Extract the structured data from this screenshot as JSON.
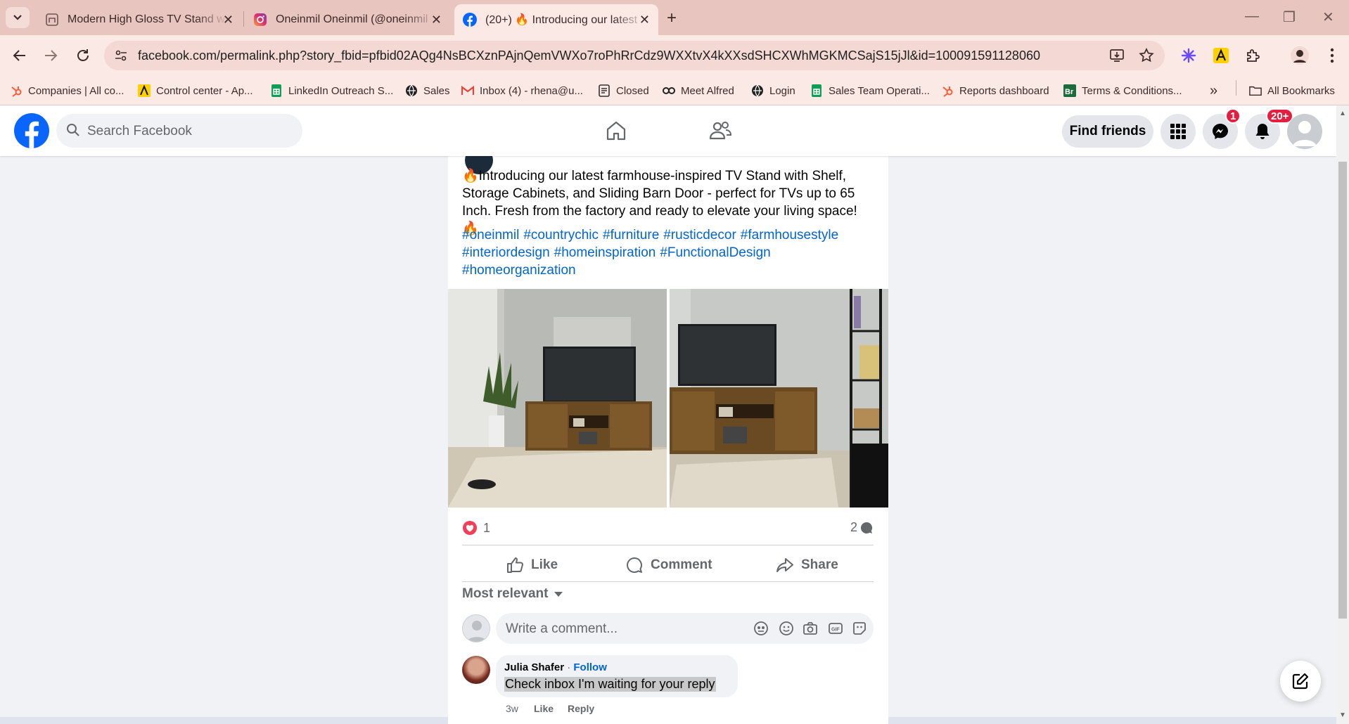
{
  "browser": {
    "tabs": [
      {
        "title": "Modern High Gloss TV Stand w"
      },
      {
        "title": "Oneinmil Oneinmil (@oneinmil"
      },
      {
        "title": "(20+) 🔥 Introducing our latest"
      }
    ],
    "url": "facebook.com/permalink.php?story_fbid=pfbid02AQg4NsBCXznPAjnQemVWXo7roPhRrCdz9WXXtvX4kXXsdSHCXWhMGKMCSajS15jJl&id=100091591128060",
    "bookmarks": [
      {
        "label": "Companies | All co...",
        "icon": "hubspot-icon"
      },
      {
        "label": "Control center - Ap...",
        "icon": "apollo-icon"
      },
      {
        "label": "LinkedIn Outreach S...",
        "icon": "sheets-icon"
      },
      {
        "label": "Sales",
        "icon": "globe-icon"
      },
      {
        "label": "Inbox (4) - rhena@u...",
        "icon": "gmail-icon"
      },
      {
        "label": "Closed",
        "icon": "doc-icon"
      },
      {
        "label": "Meet Alfred",
        "icon": "alfred-icon"
      },
      {
        "label": "Login",
        "icon": "globe-icon"
      },
      {
        "label": "Sales Team Operati...",
        "icon": "sheets-icon"
      },
      {
        "label": "Reports dashboard",
        "icon": "hubspot-icon"
      },
      {
        "label": "Terms & Conditions...",
        "icon": "br-icon"
      }
    ],
    "all_bookmarks": "All Bookmarks",
    "overflow": "»"
  },
  "facebook": {
    "search_placeholder": "Search Facebook",
    "find_friends": "Find friends",
    "messenger_badge": "1",
    "notifications_badge": "20+"
  },
  "post": {
    "text": "🔥Introducing our latest farmhouse-inspired TV Stand with Shelf, Storage Cabinets, and Sliding Barn Door - perfect for TVs up to 65 Inch. Fresh from the factory and ready to elevate your living space!🔥",
    "hashtags": [
      "#oneinmil",
      "#countrychic",
      "#furniture",
      "#rusticdecor",
      "#farmhousestyle",
      "#interiordesign",
      "#homeinspiration",
      "#FunctionalDesign",
      "#homeorganization"
    ],
    "reactions_count": "1",
    "comments_count": "2",
    "actions": {
      "like": "Like",
      "comment": "Comment",
      "share": "Share"
    },
    "sort": "Most relevant",
    "comment_placeholder": "Write a comment...",
    "comment": {
      "author": "Julia Shafer",
      "follow": "Follow",
      "separator": " · ",
      "text": "Check inbox I'm waiting for your reply",
      "age": "3w",
      "like": "Like",
      "reply": "Reply"
    }
  },
  "colors": {
    "facebook_blue": "#0866ff",
    "link_blue": "#0064d1",
    "badge_red": "#e41e3f",
    "chrome_tab_bar": "#e9c5bf"
  }
}
